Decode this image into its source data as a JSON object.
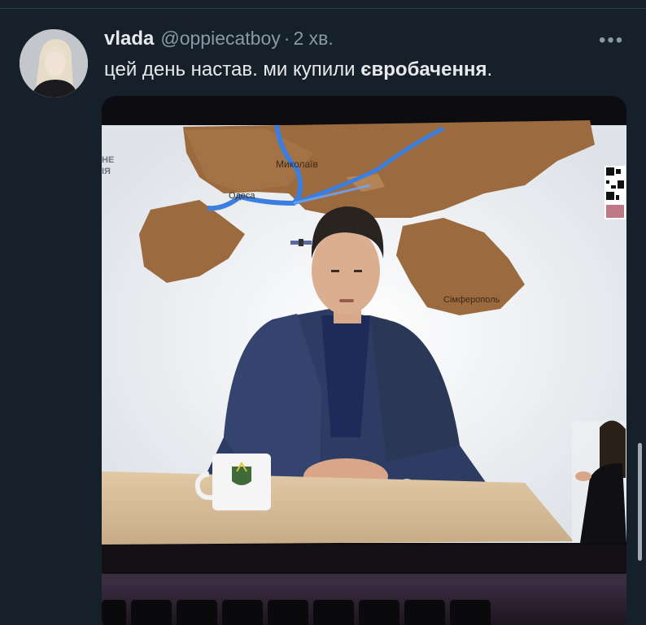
{
  "tweet": {
    "author_name": "vlada",
    "author_handle": "@oppiecatboy",
    "separator": "·",
    "timestamp": "2 хв.",
    "text_plain": "цей день настав. ми купили ",
    "text_bold": "євробачення",
    "text_end": ".",
    "more_label": "•••"
  },
  "media": {
    "map_labels": {
      "city_1": "Миколаїв",
      "city_2": "Одеса",
      "city_3": "Сімферополь",
      "corner_text_1": "НЕ",
      "corner_text_2": "ІЯ"
    },
    "icons": [
      "more-options-icon",
      "qr-code-icon",
      "keyboard-key-icons"
    ]
  },
  "colors": {
    "background": "#15202b",
    "text_primary": "#e7e9ea",
    "text_secondary": "#8b98a5",
    "map_wood": "#9b6a3e",
    "river_blue": "#3a7fe0"
  }
}
